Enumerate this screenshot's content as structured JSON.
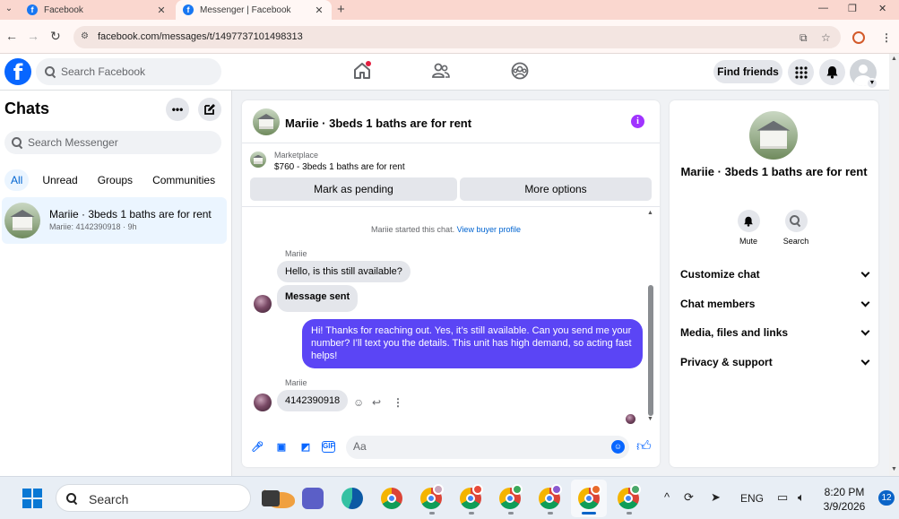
{
  "browser": {
    "tabs": [
      {
        "title": "Facebook",
        "favicon": "facebook-icon"
      },
      {
        "title": "Messenger | Facebook",
        "favicon": "facebook-icon"
      }
    ],
    "url": "facebook.com/messages/t/1497737101498313"
  },
  "header": {
    "search_placeholder": "Search Facebook",
    "find_friends": "Find friends",
    "logo_letter": "f"
  },
  "chats": {
    "title": "Chats",
    "search_placeholder": "Search Messenger",
    "filters": [
      "All",
      "Unread",
      "Groups",
      "Communities"
    ],
    "conversation": {
      "name": "Mariie · 3beds 1 baths are for rent",
      "preview": "Mariie: 4142390918 · 9h"
    }
  },
  "conversation": {
    "title": "Mariie · 3beds 1 baths are for rent",
    "marketplace_label": "Marketplace",
    "listing": "$760 - 3beds 1 baths are for rent",
    "mark_pending": "Mark as pending",
    "more_options": "More options",
    "system_text": "Mariie started this chat.",
    "system_link": "View buyer profile",
    "messages": [
      {
        "sender": "Mariie",
        "text": "Hello, is this still available?"
      },
      {
        "text": "Message sent"
      },
      {
        "text": "Hi! Thanks for reaching out. Yes, it’s still available. Can you send me your number? I’ll text you the details. This unit has high demand, so acting fast helps!"
      },
      {
        "sender": "Mariie",
        "text": "4142390918"
      }
    ],
    "composer_placeholder": "Aa"
  },
  "info_panel": {
    "name": "Mariie · 3beds 1 baths are for rent",
    "actions": [
      "Mute",
      "Search"
    ],
    "sections": [
      "Customize chat",
      "Chat members",
      "Media, files and links",
      "Privacy & support"
    ]
  },
  "taskbar": {
    "search_label": "Search",
    "language": "ENG",
    "time": "8:20 PM",
    "date": "3/9/2026",
    "notifications": "12"
  },
  "colors": {
    "facebook_blue": "#0866ff",
    "outgoing_bubble": "#5b45f5",
    "selected_chat": "#ebf5ff"
  }
}
